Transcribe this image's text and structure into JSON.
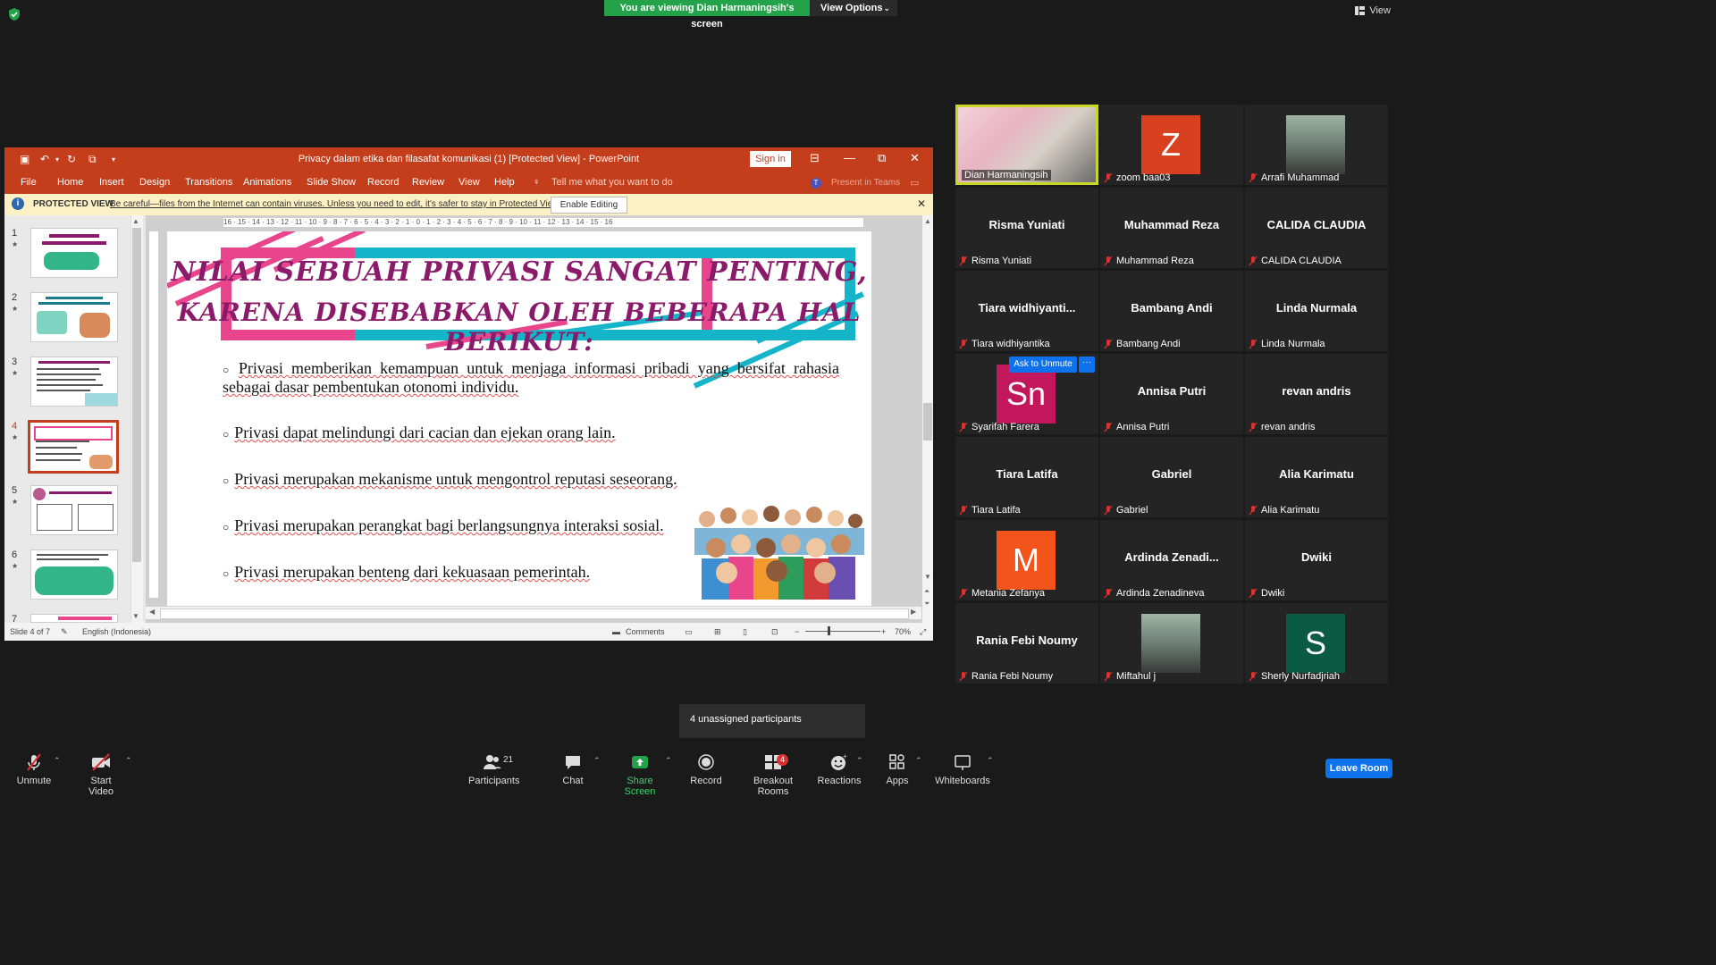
{
  "zoom": {
    "viewing_banner": "You are viewing Dian Harmaningsih's screen",
    "view_options": "View Options",
    "view_label": "View"
  },
  "ppt": {
    "doc_title": "Privacy dalam etika dan filasafat komunikasi (1) [Protected View]  -  PowerPoint",
    "sign_in": "Sign in",
    "tabs": [
      "File",
      "Home",
      "Insert",
      "Design",
      "Transitions",
      "Animations",
      "Slide Show",
      "Record",
      "Review",
      "View",
      "Help"
    ],
    "tell_me": "Tell me what you want to do",
    "present_in_teams": "Present in Teams",
    "protected_label": "PROTECTED VIEW",
    "protected_msg": "Be careful—files from the Internet can contain viruses. Unless you need to edit, it's safer to stay in Protected View.",
    "enable_editing": "Enable Editing",
    "slide_numbers": [
      "1",
      "2",
      "3",
      "4",
      "5",
      "6",
      "7"
    ],
    "status": {
      "slide_of": "Slide 4 of 7",
      "language": "English (Indonesia)",
      "comments": "Comments",
      "zoom": "70%"
    },
    "ruler": "16 · 15 · 14 · 13 · 12 · 11 · 10 · 9 · 8 · 7 · 6 · 5 · 4 · 3 · 2 · 1 · 0 · 1 · 2 · 3 · 4 · 5 · 6 · 7 · 8 · 9 · 10 · 11 · 12 · 13 · 14 · 15 · 16"
  },
  "slide": {
    "title_1": "NILAI SEBUAH PRIVASI SANGAT PENTING,",
    "title_2": "KARENA DISEBABKAN OLEH BEBERAPA HAL BERIKUT:",
    "bullets": [
      "Privasi memberikan kemampuan untuk menjaga informasi pribadi yang bersifat rahasia sebagai dasar pembentukan otonomi individu.",
      "Privasi dapat melindungi dari cacian dan ejekan orang lain.",
      "Privasi merupakan mekanisme untuk mengontrol reputasi seseorang.",
      "Privasi merupakan perangkat bagi berlangsungnya interaksi sosial.",
      "Privasi merupakan benteng dari kekuasaan pemerintah."
    ]
  },
  "participants": [
    {
      "big": "",
      "label": "Dian Harmaningsih",
      "avatar": "photo",
      "speaking": true,
      "muted": false
    },
    {
      "big": "",
      "label": "zoom baa03",
      "avatar": "Z",
      "color": "#d9401f",
      "muted": true
    },
    {
      "big": "",
      "label": "Arrafi Muhammad",
      "avatar": "photo",
      "muted": true
    },
    {
      "big": "Risma Yuniati",
      "label": "Risma Yuniati",
      "muted": true
    },
    {
      "big": "Muhammad Reza",
      "label": "Muhammad Reza",
      "muted": true
    },
    {
      "big": "CALIDA CLAUDIA",
      "label": "CALIDA CLAUDIA",
      "muted": true
    },
    {
      "big": "Tiara  widhiyanti...",
      "label": "Tiara widhiyantika",
      "muted": true
    },
    {
      "big": "Bambang Andi",
      "label": "Bambang Andi",
      "muted": true
    },
    {
      "big": "Linda Nurmala",
      "label": "Linda Nurmala",
      "muted": true
    },
    {
      "big": "",
      "label": "Syarifah Farera",
      "avatar": "Sn",
      "color": "#c2185b",
      "muted": true
    },
    {
      "big": "Annisa Putri",
      "label": "Annisa Putri",
      "muted": true
    },
    {
      "big": "revan andris",
      "label": "revan andris",
      "muted": true
    },
    {
      "big": "Tiara Latifa",
      "label": "Tiara Latifa",
      "muted": true
    },
    {
      "big": "Gabriel",
      "label": "Gabriel",
      "muted": true
    },
    {
      "big": "Alia Karimatu",
      "label": "Alia Karimatu",
      "muted": true
    },
    {
      "big": "",
      "label": "Metania Zefanya",
      "avatar": "M",
      "color": "#f2541b",
      "muted": true
    },
    {
      "big": "Ardinda  Zenadi...",
      "label": "Ardinda Zenadineva",
      "muted": true
    },
    {
      "big": "Dwiki",
      "label": "Dwiki",
      "muted": true
    },
    {
      "big": "Rania Febi Noumy",
      "label": "Rania Febi Noumy",
      "muted": true
    },
    {
      "big": "",
      "label": "Miftahul j",
      "avatar": "photo",
      "muted": true
    },
    {
      "big": "",
      "label": "Sherly Nurfadjriah",
      "avatar": "S",
      "color": "#0b5a44",
      "muted": true
    }
  ],
  "ask_to_unmute": "Ask to Unmute",
  "ask_more": "···",
  "unassigned": "4 unassigned participants",
  "toolbar": {
    "unmute": "Unmute",
    "start_video": "Start Video",
    "participants": "Participants",
    "participants_count": "21",
    "chat": "Chat",
    "share_screen": "Share Screen",
    "record": "Record",
    "breakout_rooms": "Breakout Rooms",
    "breakout_badge": "4",
    "reactions": "Reactions",
    "apps": "Apps",
    "whiteboards": "Whiteboards",
    "leave_room": "Leave Room"
  },
  "colors": {
    "ppt_accent": "#c43e1c",
    "share_green": "#23a24a",
    "zoom_blue": "#0e72ed",
    "slide_pink": "#e8458c",
    "slide_cyan": "#14b4c9",
    "title_purple": "#8a1a6a"
  }
}
